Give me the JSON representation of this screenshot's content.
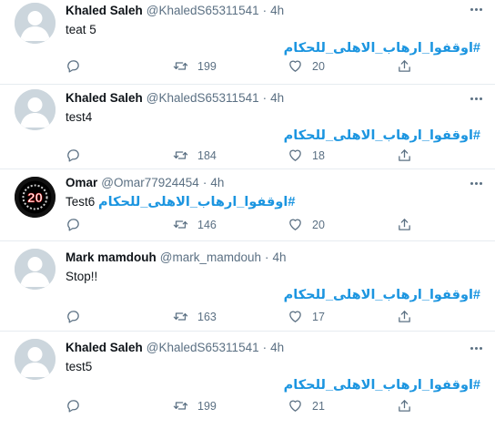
{
  "tweets": [
    {
      "name": "Khaled Saleh",
      "handle": "@KhaledS65311541",
      "dot": "·",
      "time": "4h",
      "text": "teat 5",
      "hashtag": "#اوقفوا_ارهاب_الاهلى_للحكام",
      "retweets": "199",
      "likes": "20",
      "avatar": "default"
    },
    {
      "name": "Khaled Saleh",
      "handle": "@KhaledS65311541",
      "dot": "·",
      "time": "4h",
      "text": "test4",
      "hashtag": "#اوقفوا_ارهاب_الاهلى_للحكام",
      "retweets": "184",
      "likes": "18",
      "avatar": "default"
    },
    {
      "name": "Omar",
      "handle": "@Omar77924454",
      "dot": "·",
      "time": "4h",
      "text": "Test6",
      "hashtag": "#اوقفوا_ارهاب_الاهلى_للحكام",
      "retweets": "146",
      "likes": "20",
      "avatar": "logo-20"
    },
    {
      "name": "Mark mamdouh",
      "handle": "@mark_mamdouh",
      "dot": "·",
      "time": "4h",
      "text": "Stop!!",
      "hashtag": "#اوقفوا_ارهاب_الاهلى_للحكام",
      "retweets": "163",
      "likes": "17",
      "avatar": "default"
    },
    {
      "name": "Khaled Saleh",
      "handle": "@KhaledS65311541",
      "dot": "·",
      "time": "4h",
      "text": "test5",
      "hashtag": "#اوقفوا_ارهاب_الاهلى_للحكام",
      "retweets": "199",
      "likes": "21",
      "avatar": "default"
    }
  ],
  "avatar_logo_text": "20",
  "colors": {
    "accent": "#1b95e0",
    "muted": "#5b7083",
    "divider": "#e6ecf0",
    "avatar_bg": "#ccd6dd"
  },
  "icons": {
    "reply": "reply-icon",
    "retweet": "retweet-icon",
    "like": "heart-icon",
    "share": "share-icon",
    "more": "more-icon"
  }
}
